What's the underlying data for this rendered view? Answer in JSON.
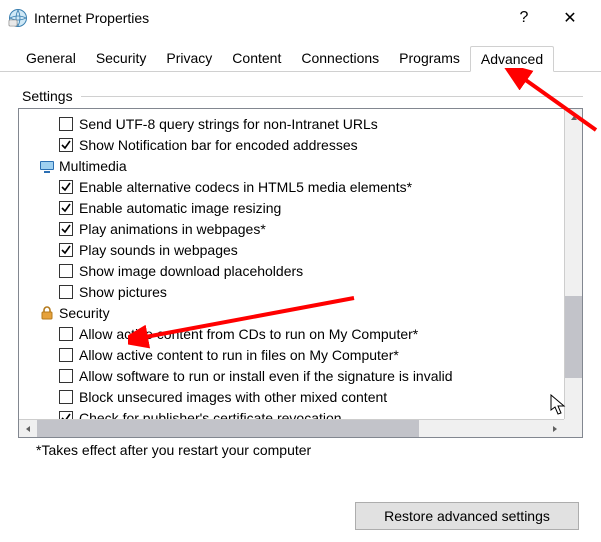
{
  "window": {
    "title": "Internet Properties",
    "help_glyph": "?",
    "close_glyph": "✕"
  },
  "tabs": [
    {
      "label": "General"
    },
    {
      "label": "Security"
    },
    {
      "label": "Privacy"
    },
    {
      "label": "Content"
    },
    {
      "label": "Connections"
    },
    {
      "label": "Programs"
    },
    {
      "label": "Advanced"
    }
  ],
  "active_tab_index": 6,
  "group_label": "Settings",
  "items": [
    {
      "kind": "check",
      "checked": false,
      "label": "Send UTF-8 query strings for non-Intranet URLs"
    },
    {
      "kind": "check",
      "checked": true,
      "label": "Show Notification bar for encoded addresses"
    },
    {
      "kind": "cat",
      "icon": "multimedia",
      "label": "Multimedia"
    },
    {
      "kind": "check",
      "checked": true,
      "label": "Enable alternative codecs in HTML5 media elements*"
    },
    {
      "kind": "check",
      "checked": true,
      "label": "Enable automatic image resizing"
    },
    {
      "kind": "check",
      "checked": true,
      "label": "Play animations in webpages*"
    },
    {
      "kind": "check",
      "checked": true,
      "label": "Play sounds in webpages"
    },
    {
      "kind": "check",
      "checked": false,
      "label": "Show image download placeholders"
    },
    {
      "kind": "check",
      "checked": false,
      "label": "Show pictures"
    },
    {
      "kind": "cat",
      "icon": "security",
      "label": "Security"
    },
    {
      "kind": "check",
      "checked": false,
      "label": "Allow active content from CDs to run on My Computer*"
    },
    {
      "kind": "check",
      "checked": false,
      "label": "Allow active content to run in files on My Computer*"
    },
    {
      "kind": "check",
      "checked": false,
      "label": "Allow software to run or install even if the signature is invalid"
    },
    {
      "kind": "check",
      "checked": false,
      "label": "Block unsecured images with other mixed content"
    },
    {
      "kind": "check",
      "checked": true,
      "label": "Check for publisher's certificate revocation",
      "cut": true
    }
  ],
  "footnote": "*Takes effect after you restart your computer",
  "restore_label": "Restore advanced settings",
  "colors": {
    "arrow": "#ff0000"
  }
}
